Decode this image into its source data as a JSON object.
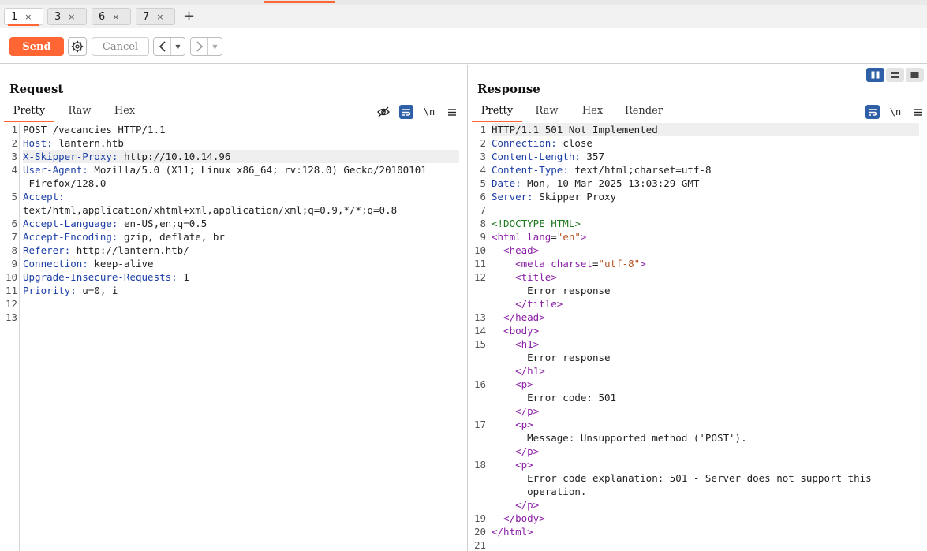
{
  "tabs": [
    {
      "label": "1",
      "close": "×",
      "active": true
    },
    {
      "label": "3",
      "close": "×",
      "active": false
    },
    {
      "label": "6",
      "close": "×",
      "active": false
    },
    {
      "label": "7",
      "close": "×",
      "active": false
    }
  ],
  "tab_add": "+",
  "toolbar": {
    "send_label": "Send",
    "cancel_label": "Cancel",
    "back_icon": "chevron-left-icon",
    "forward_icon": "chevron-right-icon"
  },
  "request": {
    "title": "Request",
    "subtabs": [
      "Pretty",
      "Raw",
      "Hex"
    ],
    "active_subtab": "Pretty",
    "newline_label": "\\n",
    "lines": [
      {
        "n": "1",
        "k": "",
        "v": "POST /vacancies HTTP/1.1"
      },
      {
        "n": "2",
        "k": "Host",
        "v": "lantern.htb"
      },
      {
        "n": "3",
        "k": "X-Skipper-Proxy",
        "v": "http://10.10.14.96"
      },
      {
        "n": "4",
        "k": "User-Agent",
        "v": "Mozilla/5.0 (X11; Linux x86_64; rv:128.0) Gecko/20100101",
        "cont": " Firefox/128.0"
      },
      {
        "n": "5",
        "k": "Accept",
        "v": "",
        "cont": "text/html,application/xhtml+xml,application/xml;q=0.9,*/*;q=0.8"
      },
      {
        "n": "6",
        "k": "Accept-Language",
        "v": "en-US,en;q=0.5"
      },
      {
        "n": "7",
        "k": "Accept-Encoding",
        "v": "gzip, deflate, br"
      },
      {
        "n": "8",
        "k": "Referer",
        "v": "http://lantern.htb/"
      },
      {
        "n": "9",
        "k": "Connection",
        "v": "keep-alive"
      },
      {
        "n": "10",
        "k": "Upgrade-Insecure-Requests",
        "v": "1"
      },
      {
        "n": "11",
        "k": "Priority",
        "v": "u=0, i"
      },
      {
        "n": "12",
        "k": "",
        "v": ""
      },
      {
        "n": "13",
        "k": "",
        "v": ""
      }
    ]
  },
  "response": {
    "title": "Response",
    "subtabs": [
      "Pretty",
      "Raw",
      "Hex",
      "Render"
    ],
    "active_subtab": "Pretty",
    "newline_label": "\\n",
    "status_line": "HTTP/1.1 501 Not Implemented",
    "headers": [
      {
        "k": "Connection",
        "v": "close"
      },
      {
        "k": "Content-Length",
        "v": "357"
      },
      {
        "k": "Content-Type",
        "v": "text/html;charset=utf-8"
      },
      {
        "k": "Date",
        "v": "Mon, 10 Mar 2025 13:03:29 GMT"
      },
      {
        "k": "Server",
        "v": "Skipper Proxy"
      }
    ],
    "doctype": "<!DOCTYPE HTML>",
    "html_lang": "en",
    "meta_charset": "utf-8",
    "title_text": "Error response",
    "h1_text": "Error response",
    "p1_text": "Error code: 501",
    "p2_text": "Message: Unsupported method ('POST').",
    "p3_text_1": "Error code explanation: 501 - Server does not support this",
    "p3_text_2": "operation.",
    "line_numbers": [
      "1",
      "2",
      "3",
      "4",
      "5",
      "6",
      "7",
      "8",
      "9",
      "10",
      "11",
      "12",
      "13",
      "14",
      "15",
      "16",
      "17",
      "18",
      "19",
      "20",
      "21"
    ]
  }
}
